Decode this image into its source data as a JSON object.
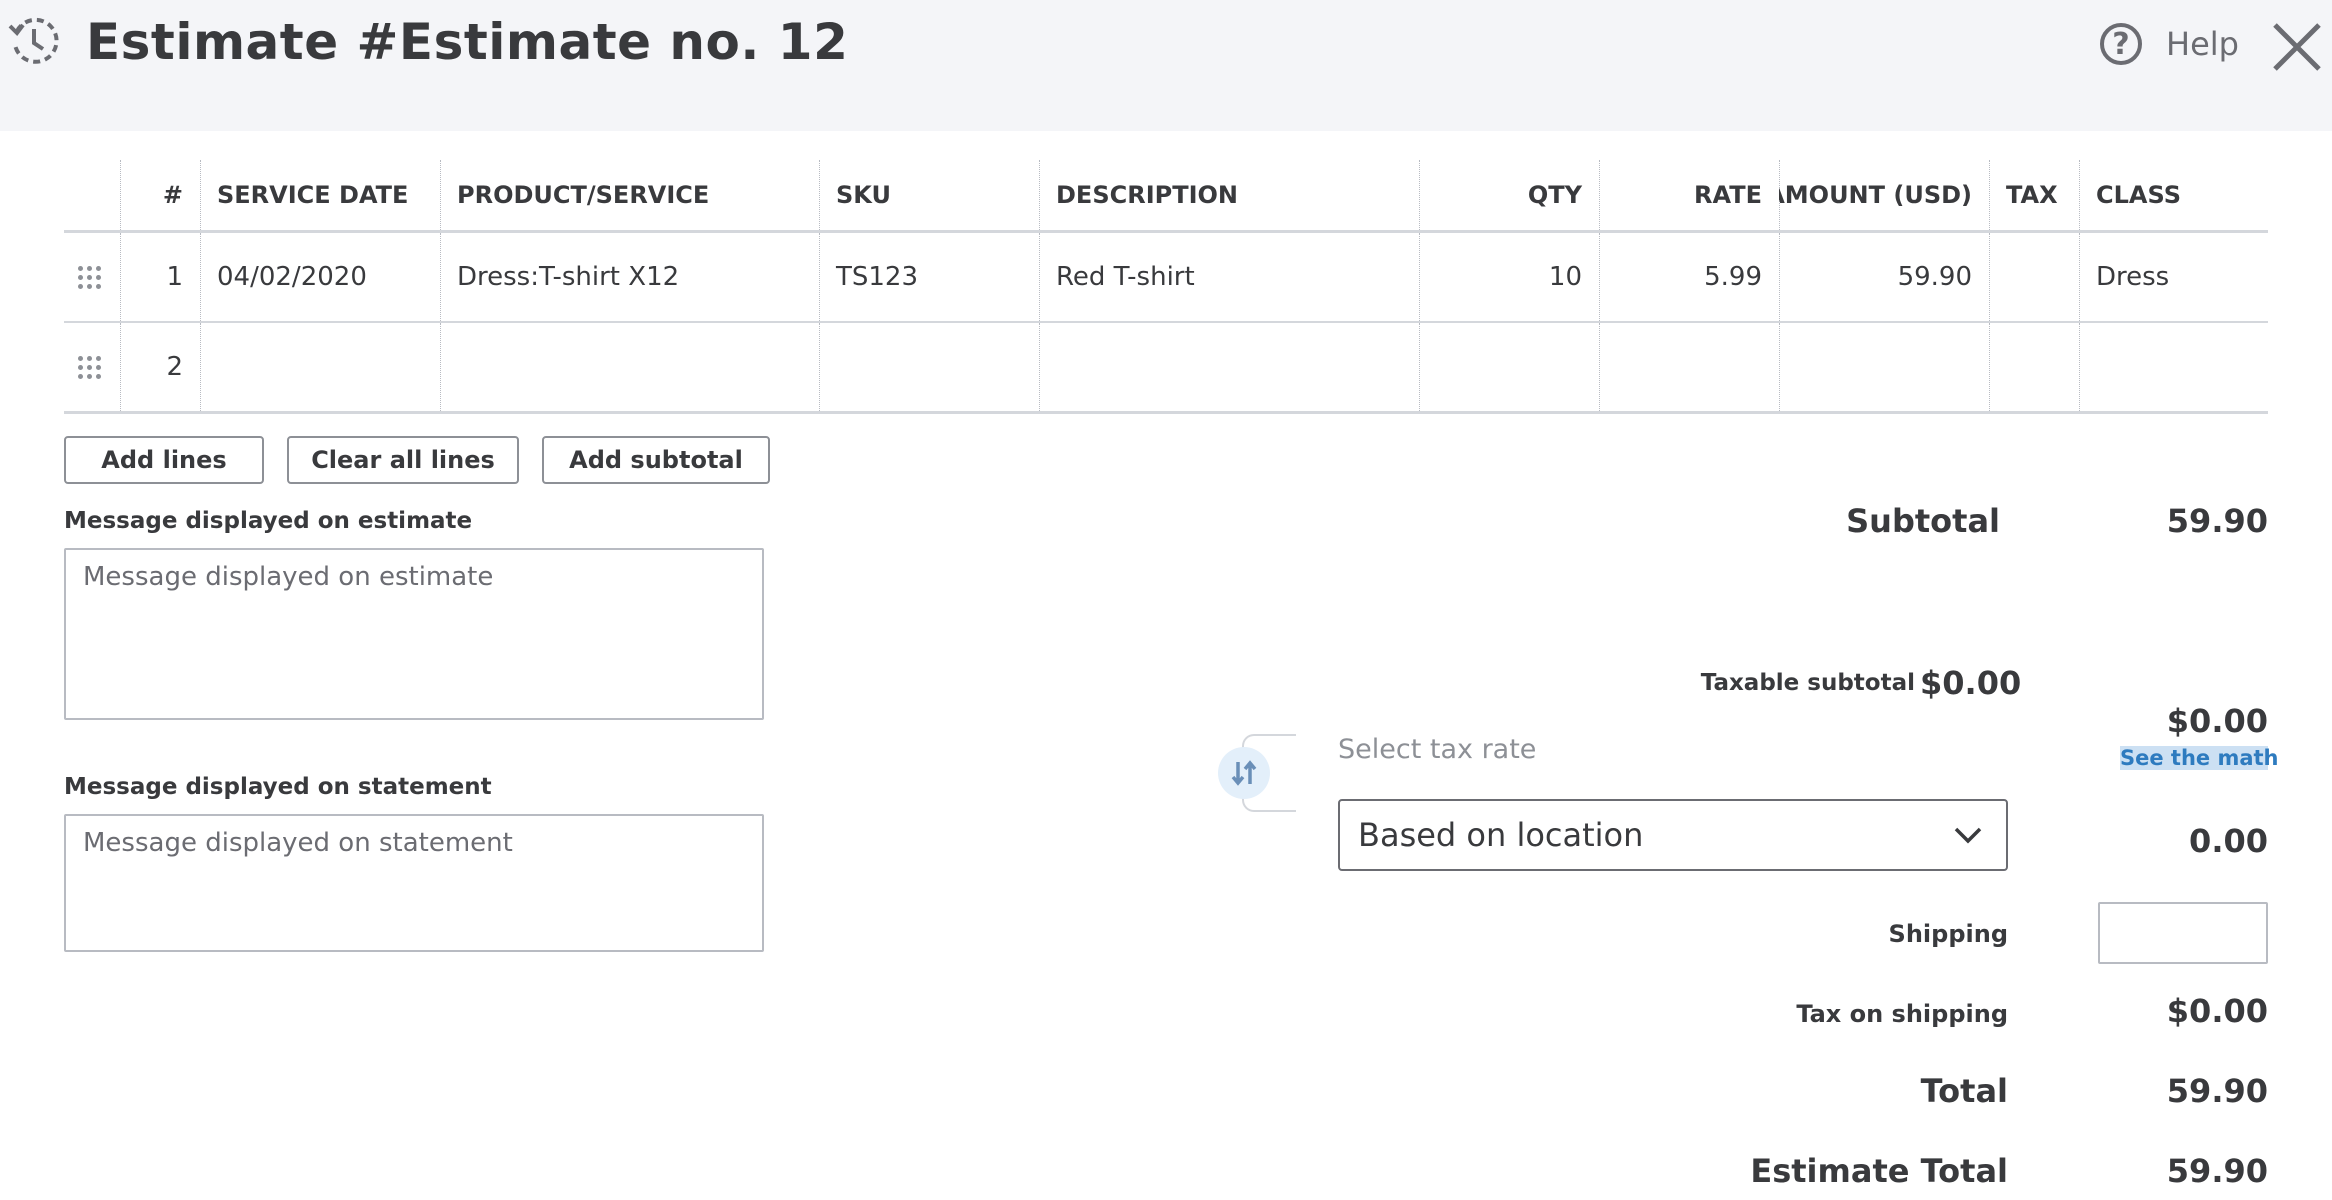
{
  "header": {
    "title": "Estimate #Estimate no. 12",
    "help_label": "Help"
  },
  "table": {
    "columns": [
      "#",
      "SERVICE DATE",
      "PRODUCT/SERVICE",
      "SKU",
      "DESCRIPTION",
      "QTY",
      "RATE",
      "AMOUNT (USD)",
      "TAX",
      "CLASS"
    ],
    "rows": [
      {
        "num": "1",
        "service_date": "04/02/2020",
        "product": "Dress:T-shirt X12",
        "sku": "TS123",
        "description": "Red T-shirt",
        "qty": "10",
        "rate": "5.99",
        "amount": "59.90",
        "tax": "",
        "class": "Dress"
      },
      {
        "num": "2",
        "service_date": "",
        "product": "",
        "sku": "",
        "description": "",
        "qty": "",
        "rate": "",
        "amount": "",
        "tax": "",
        "class": ""
      }
    ]
  },
  "buttons": {
    "add_lines": "Add lines",
    "clear_all_lines": "Clear all lines",
    "add_subtotal": "Add subtotal"
  },
  "messages": {
    "estimate_label": "Message displayed on estimate",
    "estimate_placeholder": "Message displayed on estimate",
    "statement_label": "Message displayed on statement",
    "statement_placeholder": "Message displayed on statement"
  },
  "summary": {
    "subtotal_label": "Subtotal",
    "subtotal_value": "59.90",
    "taxable_subtotal_label": "Taxable subtotal",
    "taxable_subtotal_value": "$0.00",
    "tax_amount": "$0.00",
    "see_the_math": "See the math",
    "select_tax_rate_label": "Select tax rate",
    "tax_rate_selected": "Based on location",
    "tax_value": "0.00",
    "shipping_label": "Shipping",
    "shipping_value": "",
    "tax_on_shipping_label": "Tax on shipping",
    "tax_on_shipping_value": "$0.00",
    "total_label": "Total",
    "total_value": "59.90",
    "estimate_total_label": "Estimate Total",
    "estimate_total_value": "59.90"
  },
  "colors": {
    "header_bg": "#f4f5f8",
    "text": "#393a3d",
    "link": "#2e7bbf",
    "link_highlight": "#cce0f3",
    "swap_icon_bg": "#e3effa"
  },
  "icons": {
    "history": "history-icon",
    "help": "help-icon",
    "close": "close-icon",
    "drag": "drag-handle-icon",
    "swap": "swap-icon",
    "chevron": "chevron-down-icon"
  }
}
